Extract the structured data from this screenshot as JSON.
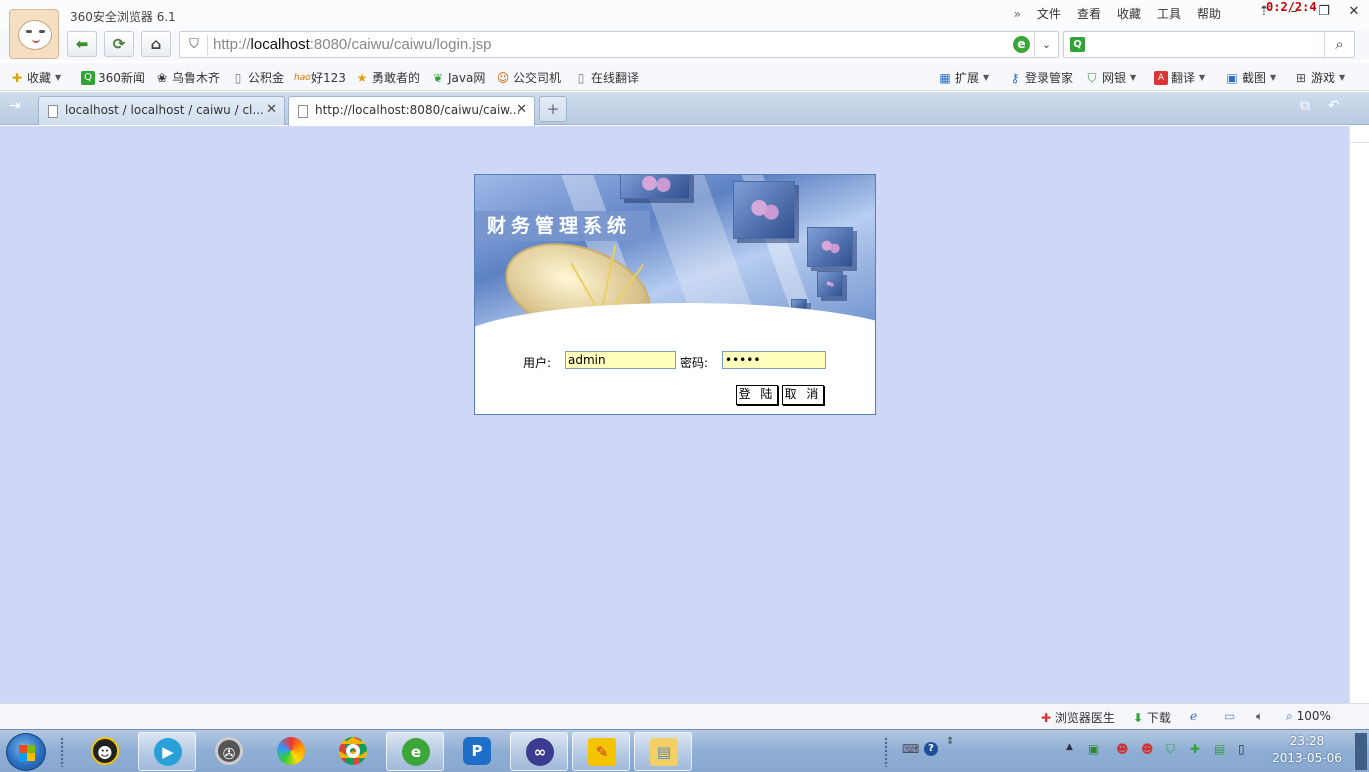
{
  "window": {
    "app_title": "360安全浏览器 6.1",
    "menu": [
      "文件",
      "查看",
      "收藏",
      "工具",
      "帮助"
    ],
    "menu_more": "»",
    "timer_overlay": "0:2/2:4"
  },
  "navigation": {
    "url_scheme": "http://",
    "url_host": "localhost",
    "url_rest": ":8080/caiwu/caiwu/login.jsp",
    "search_placeholder": ""
  },
  "bookmarks": {
    "left": [
      {
        "label": "收藏",
        "icon": "star-add-icon",
        "color": "#e0a000"
      },
      {
        "label": "360新闻",
        "icon": "search-green-icon",
        "color": "#2fa336"
      },
      {
        "label": "乌鲁木齐",
        "icon": "paw-icon",
        "color": "#333333"
      },
      {
        "label": "公积金",
        "icon": "page-icon",
        "color": "#666666"
      },
      {
        "label": "好123",
        "icon": "hao-icon",
        "color": "#e07000"
      },
      {
        "label": "勇敢者的",
        "icon": "star-icon",
        "color": "#e0a000"
      },
      {
        "label": "Java网",
        "icon": "leaf-icon",
        "color": "#2fa336"
      },
      {
        "label": "公交司机",
        "icon": "smile-icon",
        "color": "#e06000"
      },
      {
        "label": "在线翻译",
        "icon": "page-icon",
        "color": "#666666"
      }
    ],
    "right": [
      {
        "label": "扩展",
        "icon": "grid-icon"
      },
      {
        "label": "登录管家",
        "icon": "key-icon"
      },
      {
        "label": "网银",
        "icon": "shield-icon"
      },
      {
        "label": "翻译",
        "icon": "translate-icon"
      },
      {
        "label": "截图",
        "icon": "screenshot-icon"
      },
      {
        "label": "游戏",
        "icon": "gamepad-icon"
      }
    ]
  },
  "tabs": [
    {
      "label": "localhost / localhost / caiwu / cl...",
      "active": false
    },
    {
      "label": "http://localhost:8080/caiwu/caiw...",
      "active": true
    }
  ],
  "login": {
    "system_title": "财务管理系统",
    "username_label": "用户:",
    "username_value": "admin",
    "password_label": "密码:",
    "password_value": "•••••",
    "login_button": "登 陆",
    "cancel_button": "取 消"
  },
  "statusbar": {
    "doctor": "浏览器医生",
    "download": "下载",
    "zoom": "100%"
  },
  "taskbar": {
    "time": "23:28",
    "date": "2013-05-06"
  },
  "colors": {
    "page_background": "#ced7f5",
    "input_background": "#ffffbe",
    "taskbar": "#88a8d0",
    "accent_green": "#3a8a2e"
  }
}
